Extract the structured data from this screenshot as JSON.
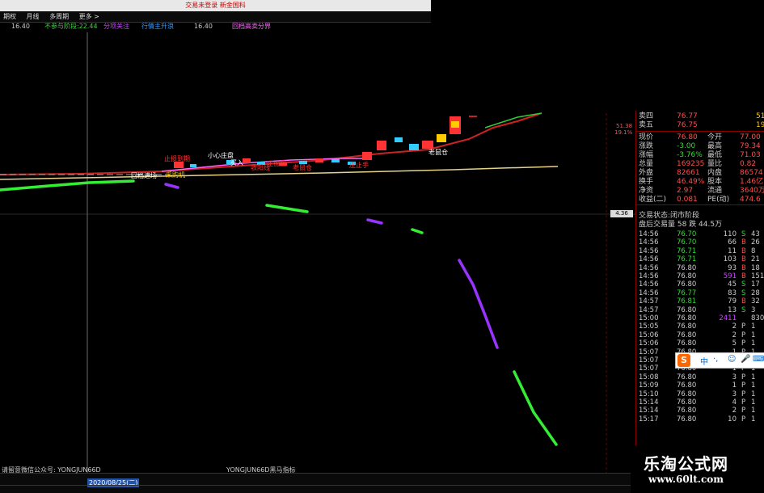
{
  "window": {
    "title": "交易未登录  新金国科"
  },
  "menu": {
    "items": [
      "期权",
      "月线",
      "多周期",
      "更多 >"
    ]
  },
  "indicators": [
    {
      "text": "16.40",
      "color": "#cccccc"
    },
    {
      "text": "不参与阶段:22.44",
      "color": "#33dd33"
    },
    {
      "text": "分项关注",
      "color": "#cc44ff"
    },
    {
      "text": "行情主升浪",
      "color": "#3399ff"
    },
    {
      "text": "16.40",
      "color": "#cccccc"
    },
    {
      "text": "回档高卖分界",
      "color": "#ff66ff"
    }
  ],
  "chart_tags": {
    "t1": "止损到期",
    "t2": "小心庄盘",
    "t3": "买入",
    "t4": "收阳线",
    "t5": "庄抛盘",
    "t6": "老鼠仓",
    "t7": "庄止手",
    "t8": "老鼠仓",
    "t9": "回档进场",
    "t10": "采购机"
  },
  "right_axis": {
    "top1": "51.38",
    "top2": "19.1%",
    "badge": "4.36"
  },
  "quote": {
    "ask4": {
      "label": "卖四",
      "price": "76.77",
      "vol": "51"
    },
    "ask5": {
      "label": "卖五",
      "price": "76.75",
      "vol": "19"
    },
    "stats": [
      {
        "l1": "现价",
        "v1": "76.80",
        "l2": "今开",
        "v2": "77.00"
      },
      {
        "l1": "涨跌",
        "v1": "-3.00",
        "l2": "最高",
        "v2": "79.34"
      },
      {
        "l1": "涨幅",
        "v1": "-3.76%",
        "l2": "最低",
        "v2": "71.03"
      },
      {
        "l1": "总量",
        "v1": "169235",
        "l2": "量比",
        "v2": "0.82"
      },
      {
        "l1": "外盘",
        "v1": "82661",
        "l2": "内盘",
        "v2": "86574"
      },
      {
        "l1": "换手",
        "v1": "46.49%",
        "l2": "股本",
        "v2": "1.46亿"
      },
      {
        "l1": "净资",
        "v1": "2.97",
        "l2": "流通",
        "v2": "3640万"
      },
      {
        "l1": "收益(二)",
        "v1": "0.081",
        "l2": "PE(动)",
        "v2": "474.6"
      }
    ],
    "status": "交易状态:闭市阶段",
    "after_hours": "盘后交易量 58 跌 44.5万"
  },
  "ticks": [
    {
      "time": "14:56",
      "price": "76.70",
      "vol": "110",
      "side": "S",
      "n": "43"
    },
    {
      "time": "14:56",
      "price": "76.70",
      "vol": "66",
      "side": "B",
      "n": "26"
    },
    {
      "time": "14:56",
      "price": "76.71",
      "vol": "11",
      "side": "B",
      "n": "8"
    },
    {
      "time": "14:56",
      "price": "76.71",
      "vol": "103",
      "side": "B",
      "n": "21"
    },
    {
      "time": "14:56",
      "price": "76.80",
      "vol": "93",
      "side": "B",
      "n": "18"
    },
    {
      "time": "14:56",
      "price": "76.80",
      "vol": "591",
      "side": "B",
      "n": "151"
    },
    {
      "time": "14:56",
      "price": "76.80",
      "vol": "45",
      "side": "S",
      "n": "17"
    },
    {
      "time": "14:56",
      "price": "76.77",
      "vol": "83",
      "side": "S",
      "n": "28"
    },
    {
      "time": "14:57",
      "price": "76.81",
      "vol": "79",
      "side": "B",
      "n": "32"
    },
    {
      "time": "14:57",
      "price": "76.80",
      "vol": "13",
      "side": "S",
      "n": "3"
    },
    {
      "time": "15:00",
      "price": "76.80",
      "vol": "2411",
      "side": "",
      "n": "830"
    },
    {
      "time": "15:05",
      "price": "76.80",
      "vol": "2",
      "side": "P",
      "n": "1"
    },
    {
      "time": "15:06",
      "price": "76.80",
      "vol": "2",
      "side": "P",
      "n": "1"
    },
    {
      "time": "15:06",
      "price": "76.80",
      "vol": "5",
      "side": "P",
      "n": "1"
    },
    {
      "time": "15:07",
      "price": "76.80",
      "vol": "1",
      "side": "P",
      "n": "1"
    },
    {
      "time": "15:07",
      "price": "76.80",
      "vol": "4",
      "side": "P",
      "n": "1"
    },
    {
      "time": "15:07",
      "price": "76.80",
      "vol": "1",
      "side": "P",
      "n": "1"
    },
    {
      "time": "15:08",
      "price": "76.80",
      "vol": "3",
      "side": "P",
      "n": "1"
    },
    {
      "time": "15:09",
      "price": "76.80",
      "vol": "1",
      "side": "P",
      "n": "1"
    },
    {
      "time": "15:10",
      "price": "76.80",
      "vol": "3",
      "side": "P",
      "n": "1"
    },
    {
      "time": "15:14",
      "price": "76.80",
      "vol": "4",
      "side": "P",
      "n": "1"
    },
    {
      "time": "15:14",
      "price": "76.80",
      "vol": "2",
      "side": "P",
      "n": "1"
    },
    {
      "time": "15:17",
      "price": "76.80",
      "vol": "10",
      "side": "P",
      "n": "1"
    }
  ],
  "bottom": {
    "left_text": "请留意微信公众号: YONGJUN66D",
    "center_text": "YONGJUN66D黑马指标",
    "date": "2020/08/25(二)"
  },
  "ime": {
    "logo": "S",
    "items": [
      "中",
      "·,",
      "☺",
      "🎤",
      "⌨",
      "♀"
    ]
  },
  "watermark": {
    "cn": "乐淘公式网",
    "url": "www.60lt.com"
  },
  "colors": {
    "up": "#ff3333",
    "down": "#33dd33",
    "flat": "#dddddd",
    "purple": "#9933ff",
    "green_seg": "#33ee33"
  }
}
